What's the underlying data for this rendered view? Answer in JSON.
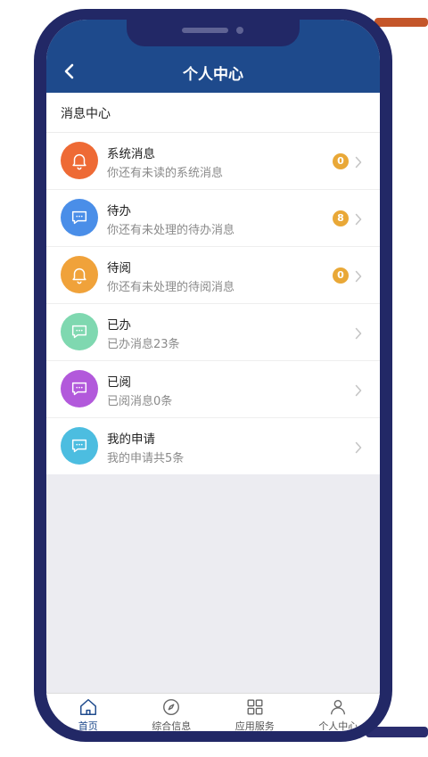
{
  "header": {
    "title": "个人中心"
  },
  "section": {
    "title": "消息中心"
  },
  "messages": [
    {
      "icon": "bell-icon",
      "color": "#ee6a35",
      "title": "系统消息",
      "subtitle": "你还有未读的系统消息",
      "badge": "0"
    },
    {
      "icon": "chat-icon",
      "color": "#4a8ee8",
      "title": "待办",
      "subtitle": "你还有未处理的待办消息",
      "badge": "8"
    },
    {
      "icon": "bell-icon",
      "color": "#f0a23a",
      "title": "待阅",
      "subtitle": "你还有未处理的待阅消息",
      "badge": "0"
    },
    {
      "icon": "chat-icon",
      "color": "#7fd8b0",
      "title": "已办",
      "subtitle": "已办消息23条"
    },
    {
      "icon": "chat-icon",
      "color": "#b259db",
      "title": "已阅",
      "subtitle": "已阅消息0条"
    },
    {
      "icon": "chat-icon",
      "color": "#4cbde0",
      "title": "我的申请",
      "subtitle": "我的申请共5条"
    }
  ],
  "tabs": [
    {
      "icon": "home-icon",
      "label": "首页",
      "active": true
    },
    {
      "icon": "compass-icon",
      "label": "综合信息"
    },
    {
      "icon": "grid-icon",
      "label": "应用服务"
    },
    {
      "icon": "person-icon",
      "label": "个人中心"
    }
  ],
  "colors": {
    "header": "#1e4a8c",
    "frame": "#222866",
    "badge": "#e9a837"
  }
}
